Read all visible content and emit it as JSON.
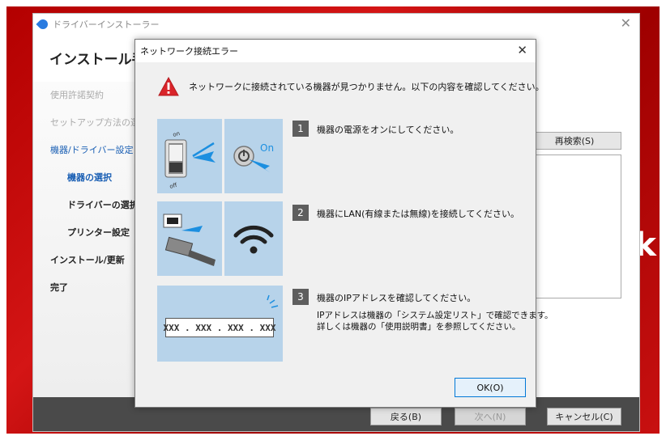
{
  "main_window": {
    "title": "ドライバーインストーラー",
    "heading": "インストール手順",
    "steps": [
      {
        "label": "使用許諾契約"
      },
      {
        "label": "セットアップ方法の選択"
      },
      {
        "label": "機器/ドライバー設定"
      },
      {
        "label": "機器の選択"
      },
      {
        "label": "ドライバーの選択"
      },
      {
        "label": "プリンター設定"
      },
      {
        "label": "インストール/更新"
      },
      {
        "label": "完了"
      }
    ],
    "rescan_label": "再検索(S)",
    "back_label": "戻る(B)",
    "next_label": "次へ(N)",
    "cancel_label": "キャンセル(C)"
  },
  "background_text": "ok",
  "dialog": {
    "title": "ネットワーク接続エラー",
    "message": "ネットワークに接続されている機器が見つかりません。以下の内容を確認してください。",
    "steps": [
      {
        "number": "1",
        "text": "機器の電源をオンにしてください。",
        "on_label": "On",
        "switch_on": "on",
        "switch_off": "off"
      },
      {
        "number": "2",
        "text": "機器にLAN(有線または無線)を接続してください。"
      },
      {
        "number": "3",
        "text": "機器のIPアドレスを確認してください。",
        "note_line1": "IPアドレスは機器の「システム設定リスト」で確認できます。",
        "note_line2": "詳しくは機器の「使用説明書」を参照してください。",
        "ip_placeholder": "XXX . XXX . XXX . XXX"
      }
    ],
    "ok_label": "OK(O)"
  },
  "colors": {
    "background_red": "#c81010",
    "accent_blue": "#0078d7",
    "tile_blue": "#b7d3ea",
    "warning_red": "#d9242a"
  }
}
